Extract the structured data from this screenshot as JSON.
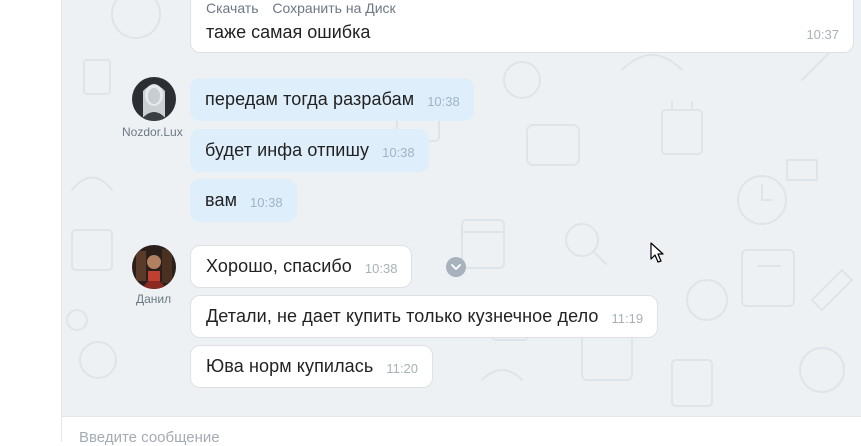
{
  "file_message": {
    "download_label": "Скачать",
    "save_disk_label": "Сохранить на Диск",
    "text": "таже самая ошибка",
    "time": "10:37"
  },
  "senders": [
    {
      "name": "Nozdor.Lux"
    },
    {
      "name": "Данил"
    }
  ],
  "messages": [
    {
      "text": "передам тогда разрабам",
      "time": "10:38"
    },
    {
      "text": "будет инфа отпишу",
      "time": "10:38"
    },
    {
      "text": "вам",
      "time": "10:38"
    },
    {
      "text": "Хорошо, спасибо",
      "time": "10:38"
    },
    {
      "text": "Детали, не дает купить только кузнечное дело",
      "time": "11:19"
    },
    {
      "text": "Юва норм купилась",
      "time": "11:20"
    }
  ],
  "composer": {
    "placeholder": "Введите сообщение"
  },
  "colors": {
    "chat_background": "#edf1f4",
    "incoming_bubble": "#dfeefb",
    "own_bubble": "#ffffff",
    "time_text": "#a9b1b8"
  },
  "icons": {
    "message_menu": "chevron-down-icon",
    "cursor": "mouse-pointer-icon"
  }
}
